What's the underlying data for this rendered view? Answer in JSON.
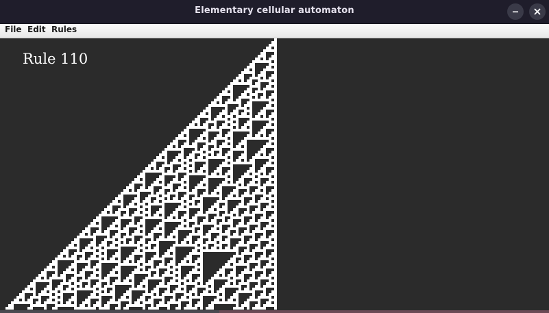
{
  "window": {
    "title": "Elementary cellular automaton",
    "minimize_icon": "minimize-icon",
    "close_icon": "close-icon"
  },
  "menu": {
    "items": [
      {
        "label": "File"
      },
      {
        "label": "Edit"
      },
      {
        "label": "Rules"
      }
    ]
  },
  "canvas": {
    "label": "Rule 110",
    "rule": 110,
    "seed": "single live cell at right edge",
    "background_color": "#2b2b2b",
    "cell_color": "#ffffff"
  }
}
